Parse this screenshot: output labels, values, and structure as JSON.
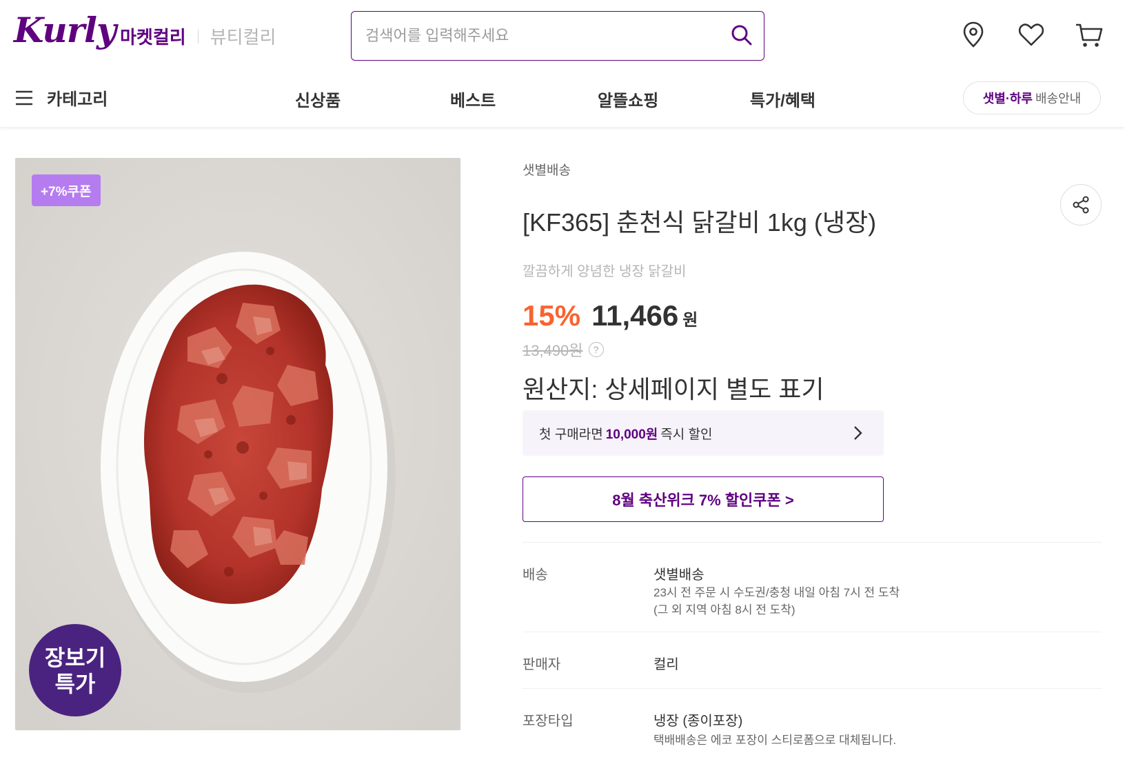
{
  "header": {
    "logo": "Kurly",
    "mall_active": "마켓컬리",
    "mall_other": "뷰티컬리",
    "search_placeholder": "검색어를 입력해주세요"
  },
  "nav": {
    "category_label": "카테고리",
    "items": [
      "신상품",
      "베스트",
      "알뜰쇼핑",
      "특가/혜택"
    ],
    "delivery_highlight": "샛별·하루",
    "delivery_label": "배송안내"
  },
  "product": {
    "coupon_badge": "+7%쿠폰",
    "special_badge_line1": "장보기",
    "special_badge_line2": "특가",
    "delivery_type": "샛별배송",
    "title": "[KF365] 춘천식 닭갈비 1kg (냉장)",
    "subtitle": "깔끔하게 양념한 냉장 닭갈비",
    "discount": "15%",
    "price": "11,466",
    "currency": "원",
    "original_price": "13,490원",
    "origin": "원산지: 상세페이지 별도 표기",
    "first_buy_prefix": "첫 구매라면",
    "first_buy_amount": "10,000원",
    "first_buy_suffix": "즉시 할인",
    "coupon_button": "8월 축산위크 7% 할인쿠폰 >"
  },
  "details": [
    {
      "label": "배송",
      "value": "샛별배송",
      "desc1": "23시 전 주문 시 수도권/충청 내일 아침 7시 전 도착",
      "desc2": "(그 외 지역 아침 8시 전 도착)"
    },
    {
      "label": "판매자",
      "value": "컬리"
    },
    {
      "label": "포장타입",
      "value": "냉장 (종이포장)",
      "desc1": "택배배송은 에코 포장이 스티로폼으로 대체됩니다."
    }
  ],
  "colors": {
    "brand": "#5f0080",
    "discount": "#fa622f",
    "badge": "#b57cf0"
  },
  "icons": [
    "search-icon",
    "location-icon",
    "heart-icon",
    "cart-icon",
    "menu-icon",
    "share-icon",
    "chevron-right-icon",
    "question-icon"
  ]
}
